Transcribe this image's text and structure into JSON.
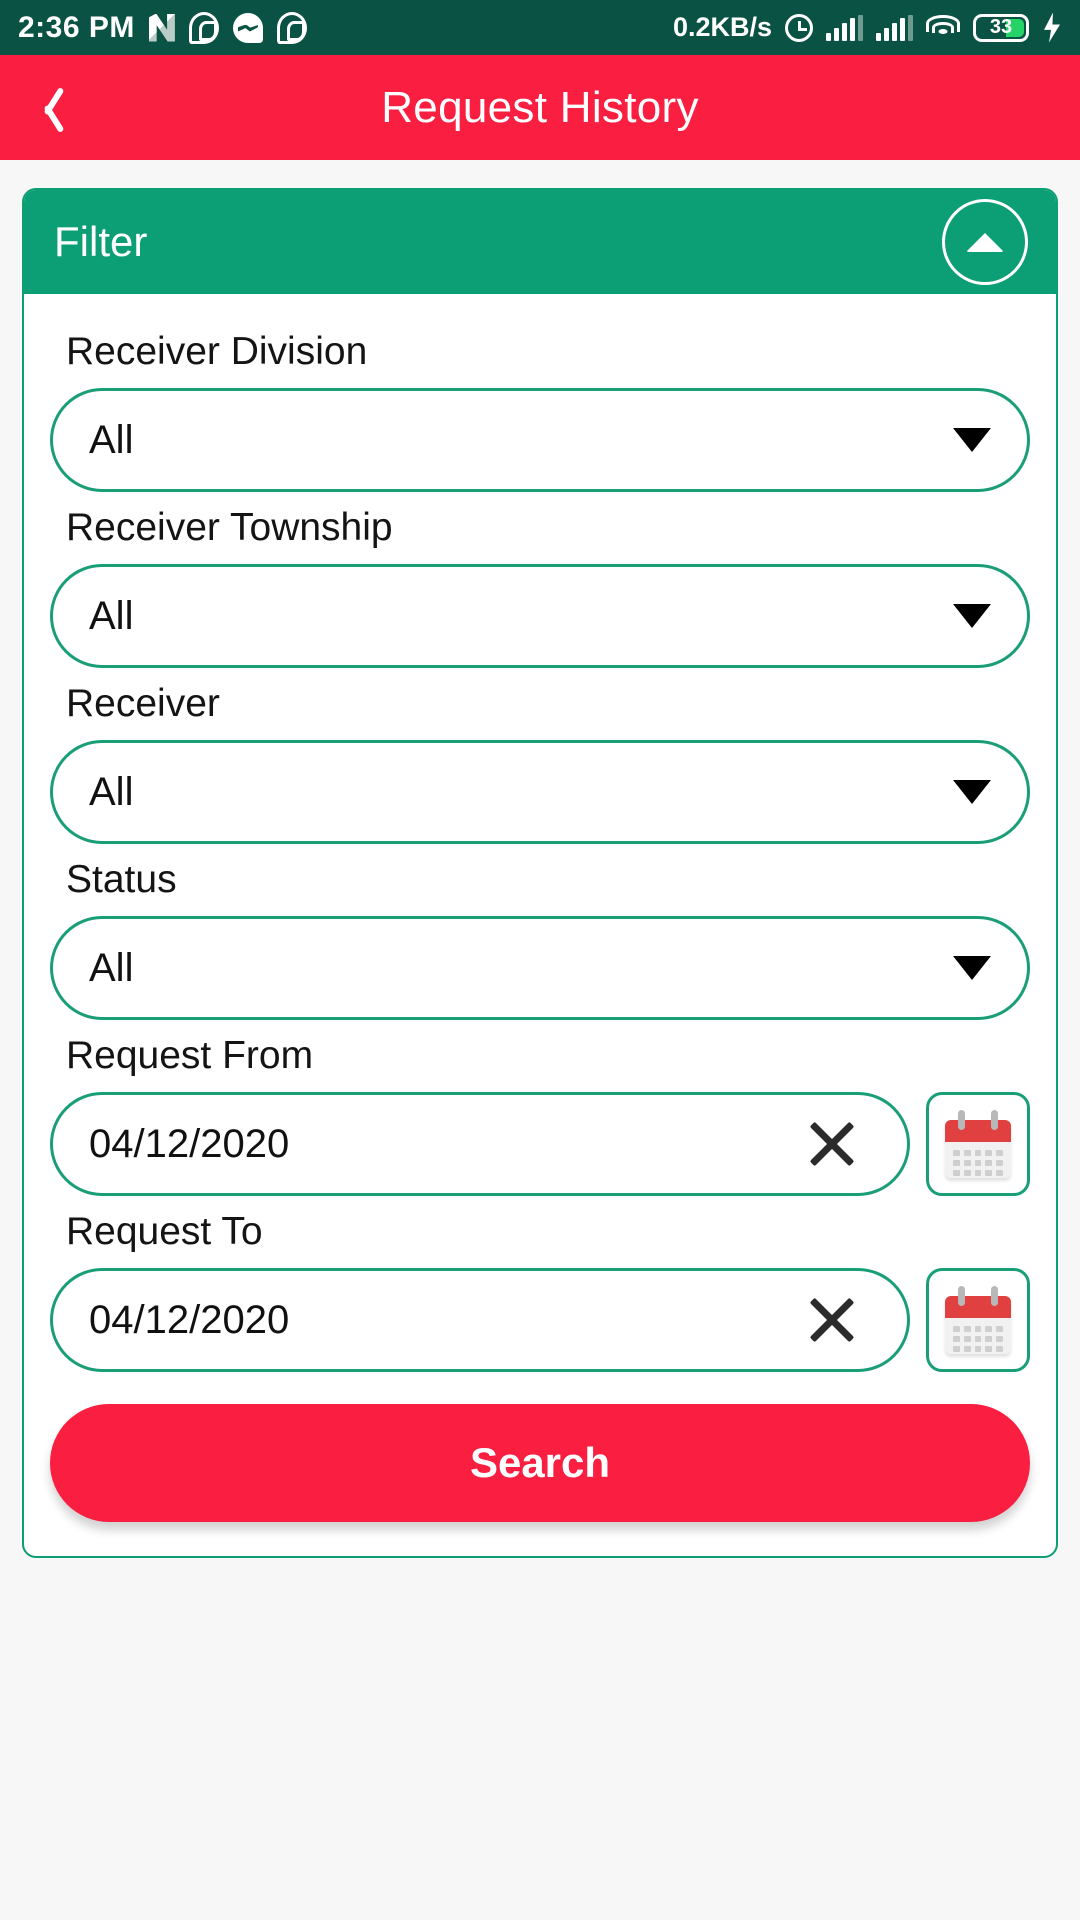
{
  "status_bar": {
    "time": "2:36 PM",
    "network_speed": "0.2KB/s",
    "battery_level": "33",
    "icons": [
      "nova-launcher-icon",
      "viber-icon",
      "messenger-icon",
      "viber-icon",
      "alarm-icon",
      "signal-bars-icon",
      "signal-bars-icon",
      "wifi-icon",
      "battery-icon",
      "charging-bolt-icon"
    ],
    "background_color": "#0a5344"
  },
  "app_bar": {
    "title": "Request History",
    "back_icon": "chevron-left-icon",
    "background_color": "#fa1e40"
  },
  "filter_card": {
    "header_title": "Filter",
    "header_color": "#0c9e74",
    "collapse_icon": "triangle-up-icon",
    "fields": [
      {
        "label": "Receiver Division",
        "type": "dropdown",
        "value": "All",
        "icon": "chevron-down-icon"
      },
      {
        "label": "Receiver Township",
        "type": "dropdown",
        "value": "All",
        "icon": "chevron-down-icon"
      },
      {
        "label": "Receiver",
        "type": "dropdown",
        "value": "All",
        "icon": "chevron-down-icon"
      },
      {
        "label": "Status",
        "type": "dropdown",
        "value": "All",
        "icon": "chevron-down-icon"
      },
      {
        "label": "Request From",
        "type": "date",
        "value": "04/12/2020",
        "clear_icon": "close-x-icon",
        "calendar_icon": "calendar-icon"
      },
      {
        "label": "Request To",
        "type": "date",
        "value": "04/12/2020",
        "clear_icon": "close-x-icon",
        "calendar_icon": "calendar-icon"
      }
    ],
    "search_label": "Search",
    "search_color": "#fa1e40"
  }
}
